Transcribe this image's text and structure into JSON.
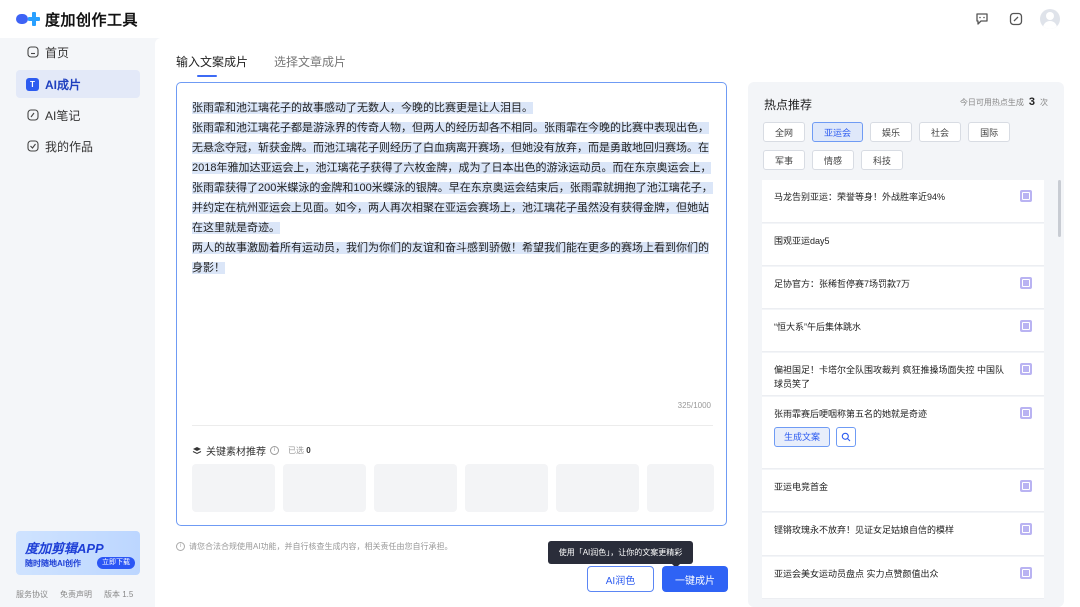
{
  "header": {
    "app_name": "度加创作工具"
  },
  "sidebar": {
    "items": [
      {
        "label": "首页",
        "icon": "home-icon"
      },
      {
        "label": "AI成片",
        "icon": "ai-film-icon",
        "badge": "T"
      },
      {
        "label": "AI笔记",
        "icon": "ai-note-icon"
      },
      {
        "label": "我的作品",
        "icon": "my-works-icon"
      }
    ],
    "promo": {
      "title": "度加剪辑APP",
      "subtitle": "随时随地AI创作",
      "button": "立即下载"
    },
    "footer": [
      "服务协议",
      "免责声明",
      "版本 1.5"
    ]
  },
  "main": {
    "tabs": [
      "输入文案成片",
      "选择文章成片"
    ],
    "editor": {
      "paragraphs": [
        "张雨霏和池江璃花子的故事感动了无数人，今晚的比赛更是让人泪目。",
        "张雨霏和池江璃花子都是游泳界的传奇人物，但两人的经历却各不相同。张雨霏在今晚的比赛中表现出色，无悬念夺冠，斩获金牌。而池江璃花子则经历了白血病离开赛场，但她没有放弃，而是勇敢地回归赛场。在2018年雅加达亚运会上，池江璃花子获得了六枚金牌，成为了日本出色的游泳运动员。而在东京奥运会上，张雨霏获得了200米蝶泳的金牌和100米蝶泳的银牌。早在东京奥运会结束后，张雨霏就拥抱了池江璃花子，并约定在杭州亚运会上见面。如今，两人再次相聚在亚运会赛场上，池江璃花子虽然没有获得金牌，但她站在这里就是奇迹。",
        "两人的故事激励着所有运动员，我们为你们的友谊和奋斗感到骄傲！希望我们能在更多的赛场上看到你们的身影！"
      ],
      "counter": "325/1000",
      "keyword_label": "关键素材推荐",
      "selected_label": "已选",
      "selected_count": "0"
    },
    "notice": "请您合法合规使用AI功能，并自行核查生成内容，相关责任由您自行承担。",
    "tooltip": "使用「AI润色」，让你的文案更精彩",
    "polish_button": "AI润色",
    "generate_button": "一键成片"
  },
  "hot": {
    "title": "热点推荐",
    "quota_prefix": "今日可用热点生成",
    "quota_count": "3",
    "quota_suffix": "次",
    "tags": [
      "全网",
      "亚运会",
      "娱乐",
      "社会",
      "国际",
      "军事",
      "情感",
      "科技"
    ],
    "active_tag": "亚运会",
    "items": [
      "马龙告别亚运：荣誉等身！外战胜率近94%",
      "围观亚运day5",
      "足协官方：张稀哲停赛7场罚款7万",
      "“恒大系”午后集体跳水",
      "偏袒国足！卡塔尔全队围攻裁判 疯狂推搡场面失控 中国队球员笑了",
      "张雨霏赛后哽咽称第五名的她就是奇迹",
      "亚运电竞首金",
      "铿锵玫瑰永不放弃！见证女足姑娘自信的模样",
      "亚运会美女运动员盘点 实力点赞颜值出众"
    ],
    "expanded_item_action": "生成文案"
  }
}
